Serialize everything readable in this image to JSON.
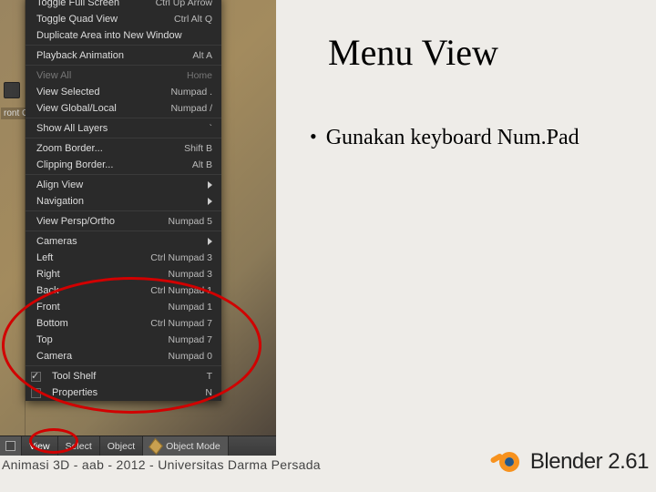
{
  "slide": {
    "title": "Menu View",
    "bullet": "Gunakan keyboard Num.Pad"
  },
  "footer": {
    "credit": "Animasi 3D - aab - 2012 - Universitas Darma Persada",
    "logo_text": "Blender 2.61"
  },
  "viewport_label": "ront O",
  "menu": {
    "items": [
      {
        "label": "Toggle Full Screen",
        "shortcut": "Ctrl Up Arrow",
        "sep": false
      },
      {
        "label": "Toggle Quad View",
        "shortcut": "Ctrl Alt Q",
        "sep": false
      },
      {
        "label": "Duplicate Area into New Window",
        "shortcut": "",
        "sep": true
      },
      {
        "label": "Playback Animation",
        "shortcut": "Alt A",
        "sep": true
      },
      {
        "label": "View All",
        "shortcut": "Home",
        "sep": false,
        "dim": true
      },
      {
        "label": "View Selected",
        "shortcut": "Numpad .",
        "sep": false
      },
      {
        "label": "View Global/Local",
        "shortcut": "Numpad /",
        "sep": true
      },
      {
        "label": "Show All Layers",
        "shortcut": "`",
        "sep": true
      },
      {
        "label": "Zoom Border...",
        "shortcut": "Shift B",
        "sep": false
      },
      {
        "label": "Clipping Border...",
        "shortcut": "Alt B",
        "sep": true
      },
      {
        "label": "Align View",
        "shortcut": "",
        "sep": false,
        "submenu": true
      },
      {
        "label": "Navigation",
        "shortcut": "",
        "sep": true,
        "submenu": true
      },
      {
        "label": "View Persp/Ortho",
        "shortcut": "Numpad 5",
        "sep": true
      },
      {
        "label": "Cameras",
        "shortcut": "",
        "sep": false,
        "submenu": true
      },
      {
        "label": "Left",
        "shortcut": "Ctrl Numpad 3",
        "sep": false
      },
      {
        "label": "Right",
        "shortcut": "Numpad 3",
        "sep": false
      },
      {
        "label": "Back",
        "shortcut": "Ctrl Numpad 1",
        "sep": false
      },
      {
        "label": "Front",
        "shortcut": "Numpad 1",
        "sep": false
      },
      {
        "label": "Bottom",
        "shortcut": "Ctrl Numpad 7",
        "sep": false
      },
      {
        "label": "Top",
        "shortcut": "Numpad 7",
        "sep": false
      },
      {
        "label": "Camera",
        "shortcut": "Numpad 0",
        "sep": true
      }
    ],
    "checks": [
      {
        "label": "Tool Shelf",
        "shortcut": "T",
        "checked": true
      },
      {
        "label": "Properties",
        "shortcut": "N",
        "checked": false
      }
    ]
  },
  "toolbar": {
    "view": "View",
    "select": "Select",
    "object": "Object",
    "mode": "Object Mode"
  }
}
